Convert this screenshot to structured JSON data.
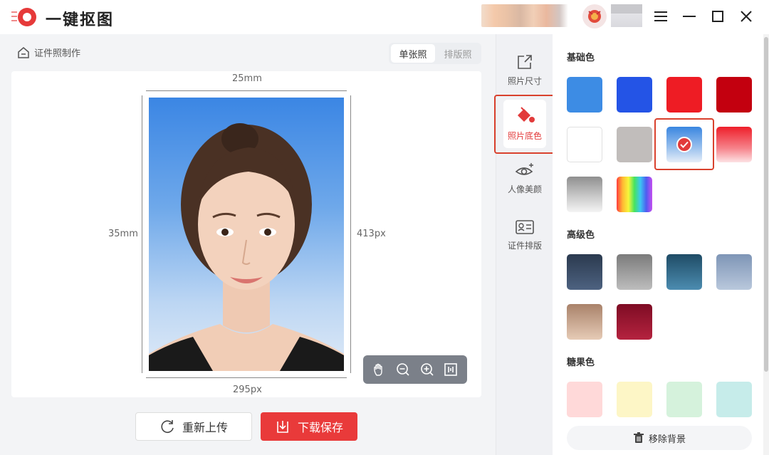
{
  "app": {
    "title": "一键抠图"
  },
  "workspace": {
    "breadcrumb": "证件照制作",
    "view_tabs": [
      {
        "label": "单张照",
        "active": true
      },
      {
        "label": "排版照",
        "active": false
      }
    ],
    "dims": {
      "width_mm": "25mm",
      "height_mm": "35mm",
      "width_px": "295px",
      "height_px": "413px"
    },
    "tools": [
      "hand-icon",
      "zoom-out-icon",
      "zoom-in-icon",
      "fit-icon"
    ]
  },
  "actions": {
    "reupload_label": "重新上传",
    "download_label": "下载保存"
  },
  "side_nav": [
    {
      "label": "照片尺寸",
      "icon": "resize-icon",
      "active": false
    },
    {
      "label": "照片底色",
      "icon": "paint-bucket-icon",
      "active": true
    },
    {
      "label": "人像美颜",
      "icon": "eye-sparkle-icon",
      "active": false
    },
    {
      "label": "证件排版",
      "icon": "id-card-icon",
      "active": false
    }
  ],
  "color_panel": {
    "basic_title": "基础色",
    "advanced_title": "高级色",
    "candy_title": "糖果色",
    "remove_bg_label": "移除背景",
    "basic": [
      {
        "fill": "#3d8ce4"
      },
      {
        "fill": "#2454e6"
      },
      {
        "fill": "#ee1c24"
      },
      {
        "fill": "#c3000f"
      },
      {
        "fill": "#ffffff"
      },
      {
        "fill": "#c1bdbb"
      },
      {
        "fill": "linear-gradient(180deg,#3a86e0 0%,#9cc2ee 60%,#e6eef8 100%)",
        "selected": true
      },
      {
        "fill": "linear-gradient(180deg,#ee1f2a 0%,#f6828a 60%,#fde2e4 100%)"
      },
      {
        "fill": "linear-gradient(180deg,#8f8f8f 0%,#c9c9c9 55%,#f4f4f4 100%)"
      },
      {
        "fill": "linear-gradient(90deg,#ff3d3d,#ffb833,#f7f73a,#46e35f,#3bc7f2,#4e5cf0,#c64ef0)"
      }
    ],
    "advanced": [
      {
        "fill": "linear-gradient(180deg,#2b3a4f 0%,#4d6280 100%)"
      },
      {
        "fill": "linear-gradient(180deg,#7b7b7b 0%,#bdbdbd 100%)"
      },
      {
        "fill": "linear-gradient(180deg,#1f4c66 0%,#4c8cb0 100%)"
      },
      {
        "fill": "linear-gradient(180deg,#7e95b6 0%,#b9c8dc 100%)"
      },
      {
        "fill": "linear-gradient(180deg,#a9826a 0%,#e6cbb6 100%)"
      },
      {
        "fill": "linear-gradient(180deg,#7e0c24 0%,#b5233f 100%)"
      }
    ],
    "candy": [
      {
        "fill": "#ffd9d9"
      },
      {
        "fill": "#fdf6c6"
      },
      {
        "fill": "#d5f2dc"
      },
      {
        "fill": "#c6ecea"
      }
    ]
  }
}
